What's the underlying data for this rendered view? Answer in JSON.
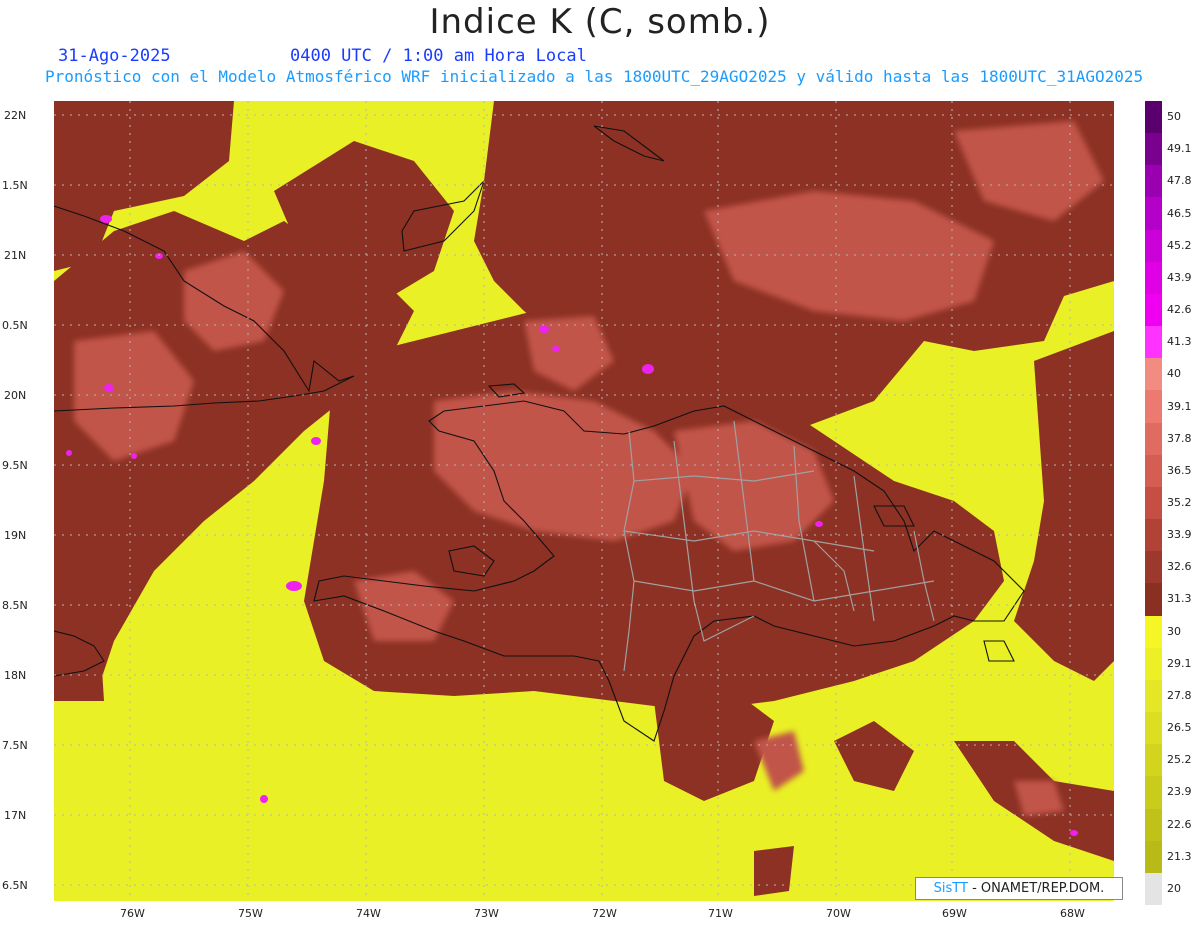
{
  "header": {
    "title": "Indice K (C, somb.)",
    "date": "31-Ago-2025",
    "time": "0400 UTC / 1:00 am Hora Local",
    "forecast": "Pronóstico con el Modelo Atmosférico WRF inicializado a las 1800UTC_29AGO2025 y válido hasta las  1800UTC_31AGO2025"
  },
  "axes": {
    "lat_labels": [
      "22N",
      "1.5N",
      "21N",
      "0.5N",
      "20N",
      "9.5N",
      "19N",
      "8.5N",
      "18N",
      "7.5N",
      "17N",
      "6.5N"
    ],
    "lon_labels": [
      "76W",
      "75W",
      "74W",
      "73W",
      "72W",
      "71W",
      "70W",
      "69W",
      "68W"
    ]
  },
  "colorbar": {
    "labels": [
      "50",
      "49.1",
      "47.8",
      "46.5",
      "45.2",
      "43.9",
      "42.6",
      "41.3",
      "40",
      "39.1",
      "37.8",
      "36.5",
      "35.2",
      "33.9",
      "32.6",
      "31.3",
      "30",
      "29.1",
      "27.8",
      "26.5",
      "25.2",
      "23.9",
      "22.6",
      "21.3",
      "20"
    ],
    "colors": [
      "#5a006e",
      "#7a0090",
      "#9a00b0",
      "#b400c8",
      "#cc00d8",
      "#e000e6",
      "#f000f0",
      "#ff33ff",
      "#f28b82",
      "#ec7a70",
      "#e06b60",
      "#d45e52",
      "#c54f43",
      "#b04236",
      "#9c382c",
      "#8a3022",
      "#f6f626",
      "#eef026",
      "#e4e626",
      "#dcde22",
      "#d2d41e",
      "#cacc1c",
      "#c0c21a",
      "#b8ba18",
      "#e4e4e4"
    ]
  },
  "credit": {
    "brand": "SisTT",
    "text": "- ONAMET/REP.DOM."
  }
}
